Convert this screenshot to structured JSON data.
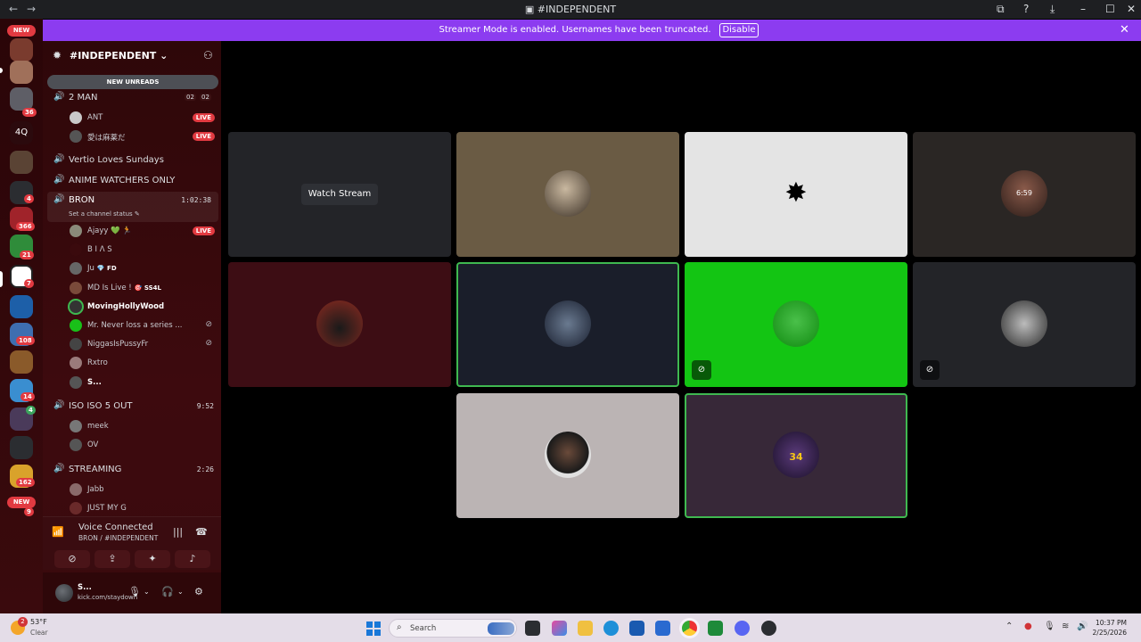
{
  "window": {
    "title": "#INDEPENDENT"
  },
  "banner": {
    "text": "Streamer Mode is enabled. Usernames have been truncated.",
    "button": "Disable"
  },
  "rail": {
    "new_top": "NEW",
    "new_bottom": "NEW",
    "server_4q": "4Q",
    "badges": [
      "36",
      "4",
      "366",
      "21",
      "7",
      "108",
      "14",
      "4",
      "162",
      "9"
    ]
  },
  "guild": {
    "name": "#INDEPENDENT",
    "new_unreads": "NEW UNREADS"
  },
  "channels": {
    "two_man": {
      "name": "2 MAN",
      "count_a": "02",
      "count_b": "02"
    },
    "ant": {
      "name": "ANT",
      "live": "LIVE"
    },
    "ai": {
      "name": "愛は麻薬だ",
      "live": "LIVE"
    },
    "vertio": {
      "name": "Vertio Loves Sundays"
    },
    "anime": {
      "name": "ANIME WATCHERS ONLY"
    },
    "bron": {
      "name": "BRON",
      "time": "1:02:38",
      "status": "Set a channel status"
    },
    "bron_members": [
      {
        "name": "Ajayy 💚 🏃",
        "live": "LIVE"
      },
      {
        "name": "B I Λ S"
      },
      {
        "name": "Ju",
        "tag": "💎 FD"
      },
      {
        "name": "MD Is Live !",
        "tag": "🎯 SS4L"
      },
      {
        "name": "MovingHollyWood"
      },
      {
        "name": "Mr. Never loss a series ..."
      },
      {
        "name": "NiggasIsPussyFr"
      },
      {
        "name": "Rxtro"
      },
      {
        "name": "S..."
      }
    ],
    "iso": {
      "name": "ISO ISO 5 OUT",
      "time": "9:52",
      "members": [
        "meek",
        "OV"
      ]
    },
    "streaming": {
      "name": "STREAMING",
      "time": "2:26",
      "members": [
        "Jabb",
        "JUST MY G"
      ]
    }
  },
  "voice": {
    "status": "Voice Connected",
    "location": "BRON / #INDEPENDENT"
  },
  "user": {
    "name": "S...",
    "status": "kick.com/staydown"
  },
  "stage": {
    "watch_label": "Watch Stream",
    "tile3_time": "6:59"
  },
  "taskbar": {
    "temp": "53°F",
    "weather": "Clear",
    "weather_badge": "2",
    "search_placeholder": "Search",
    "time": "10:37 PM",
    "date": "2/25/2026"
  },
  "colors": {
    "banner": "#8c3cf0",
    "live": "#e23a41",
    "speaking": "#3fb950"
  }
}
